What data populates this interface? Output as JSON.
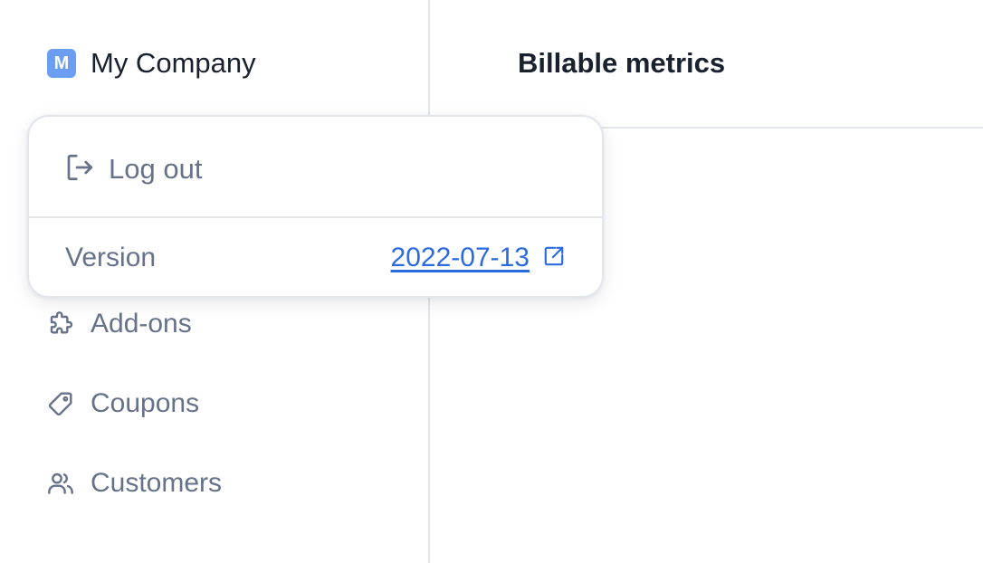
{
  "org": {
    "initial": "M",
    "name": "My Company"
  },
  "main": {
    "title": "Billable metrics"
  },
  "popover": {
    "logout_label": "Log out",
    "version_label": "Version",
    "version_value": "2022-07-13"
  },
  "nav": {
    "items": [
      {
        "label": "Add-ons",
        "icon": "puzzle-icon"
      },
      {
        "label": "Coupons",
        "icon": "tag-icon"
      },
      {
        "label": "Customers",
        "icon": "users-icon"
      }
    ]
  },
  "colors": {
    "brand": "#6b9ef3",
    "link": "#2b6be0",
    "muted_text": "#66728a",
    "text": "#19212e",
    "border": "#e3e6ec"
  }
}
